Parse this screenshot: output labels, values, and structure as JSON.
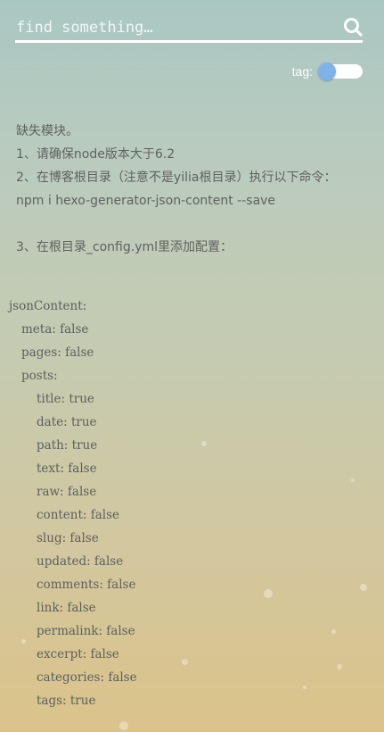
{
  "search": {
    "placeholder": "find something…",
    "icon": "search-icon"
  },
  "tag_toggle": {
    "label": "tag:",
    "state": "off",
    "knob_color": "#7fb2e8"
  },
  "notice": {
    "lines": [
      "缺失模块。",
      "1、请确保node版本大于6.2",
      "2、在博客根目录（注意不是yilia根目录）执行以下命令：",
      "npm i hexo-generator-json-content --save",
      "3、在根目录_config.yml里添加配置："
    ]
  },
  "config": {
    "root_key": "jsonContent:",
    "meta": "meta: false",
    "pages": "pages: false",
    "posts_key": "posts:",
    "posts": [
      "title: true",
      "date: true",
      "path: true",
      "text: false",
      "raw: false",
      "content: false",
      "slug: false",
      "updated: false",
      "comments: false",
      "link: false",
      "permalink: false",
      "excerpt: false",
      "categories: false",
      "tags: true"
    ]
  },
  "colors": {
    "text": "#5f625f",
    "search_underline": "#ffffff"
  }
}
